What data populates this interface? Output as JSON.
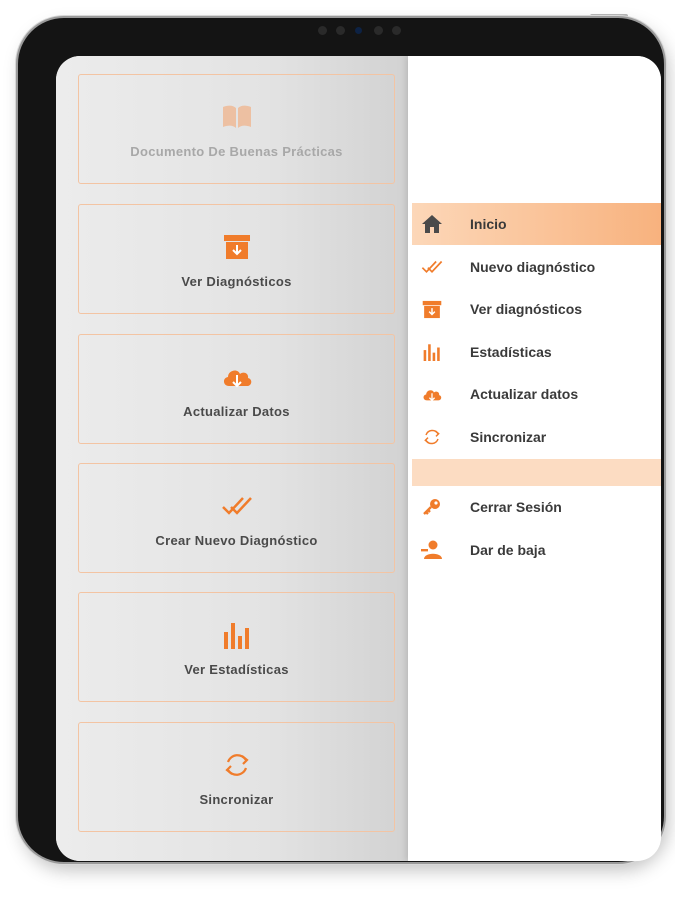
{
  "colors": {
    "accent": "#f07c2b",
    "active_gradient_start": "#fcd7b8",
    "active_gradient_end": "#f8b27e",
    "card_border": "#f3c4a3"
  },
  "main": {
    "cards": [
      {
        "label": "Documento De Buenas Prácticas",
        "icon": "open-book-icon"
      },
      {
        "label": "Ver Diagnósticos",
        "icon": "archive-box-icon"
      },
      {
        "label": "Actualizar Datos",
        "icon": "cloud-download-icon"
      },
      {
        "label": "Crear Nuevo Diagnóstico",
        "icon": "double-check-icon"
      },
      {
        "label": "Ver Estadísticas",
        "icon": "bar-chart-icon"
      },
      {
        "label": "Sincronizar",
        "icon": "sync-icon"
      }
    ]
  },
  "drawer": {
    "items": [
      {
        "label": "Inicio",
        "icon": "home-icon",
        "active": true
      },
      {
        "label": "Nuevo diagnóstico",
        "icon": "double-check-icon"
      },
      {
        "label": "Ver diagnósticos",
        "icon": "archive-box-icon"
      },
      {
        "label": "Estadísticas",
        "icon": "bar-chart-icon"
      },
      {
        "label": "Actualizar datos",
        "icon": "cloud-download-icon"
      },
      {
        "label": "Sincronizar",
        "icon": "sync-icon"
      }
    ],
    "account_items": [
      {
        "label": "Cerrar Sesión",
        "icon": "key-icon"
      },
      {
        "label": "Dar de baja",
        "icon": "user-remove-icon"
      }
    ]
  }
}
